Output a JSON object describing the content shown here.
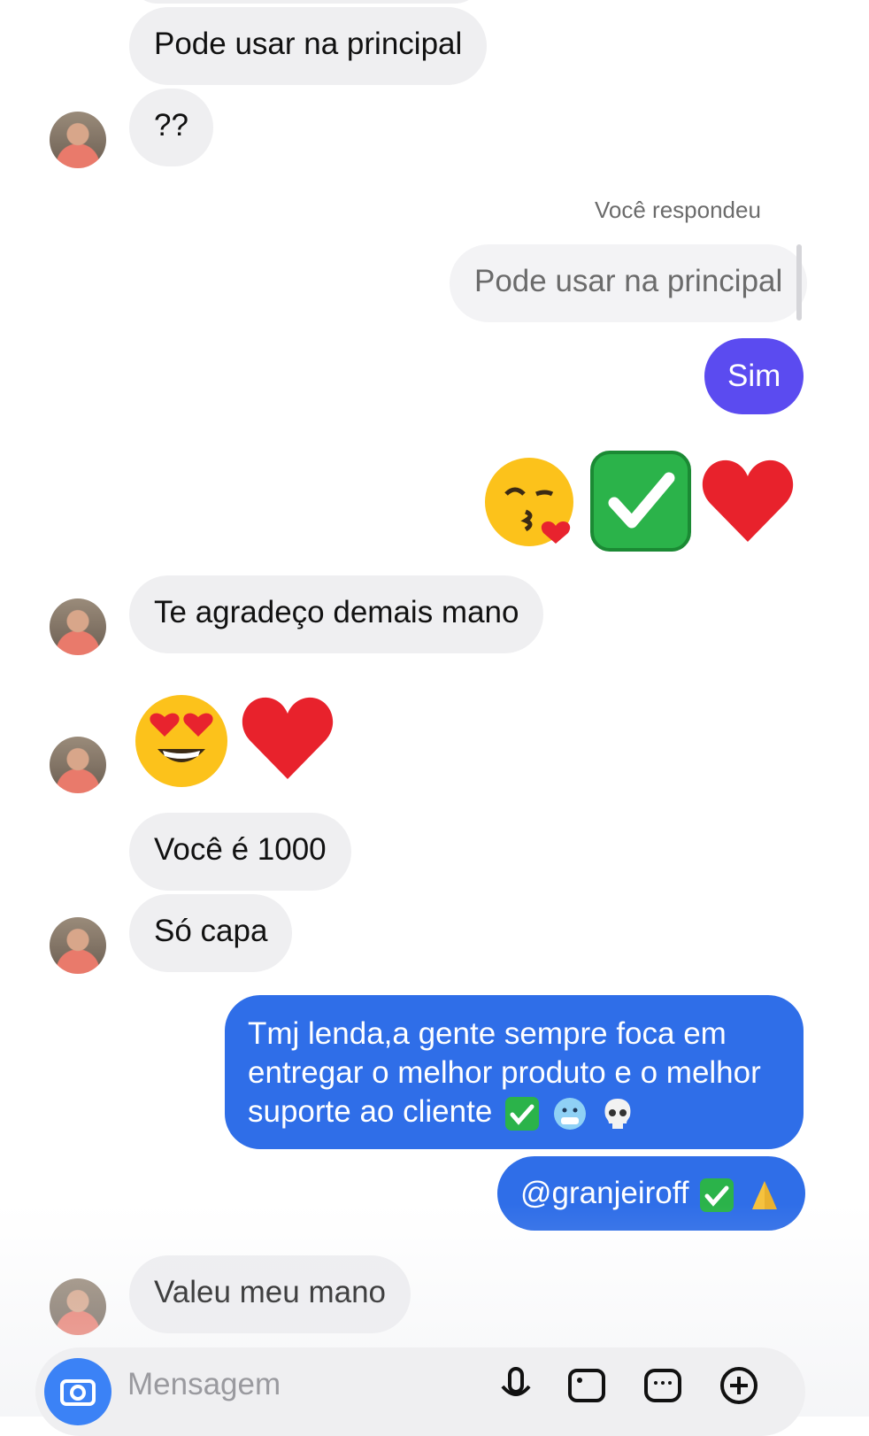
{
  "messages": {
    "m1": "Pode usar na principal",
    "m2": "??",
    "reply_label": "Você respondeu",
    "reply_quote": "Pode usar na principal",
    "m3": "Sim",
    "m5": "Te agradeço demais mano",
    "m7": "Você é 1000",
    "m8": "Só capa",
    "m9": "Tmj lenda,a gente sempre foca em entregar o melhor produto e o melhor suporte ao cliente",
    "m10": "@granjeiroff",
    "m11": "Valeu meu mano"
  },
  "composer": {
    "placeholder": "Mensagem"
  },
  "colors": {
    "incoming_bubble": "#efeff1",
    "outgoing_purple": "#5b4bf0",
    "outgoing_blue": "#2f6ee8"
  },
  "icons": [
    "camera-icon",
    "microphone-icon",
    "image-icon",
    "sticker-icon",
    "plus-icon"
  ]
}
